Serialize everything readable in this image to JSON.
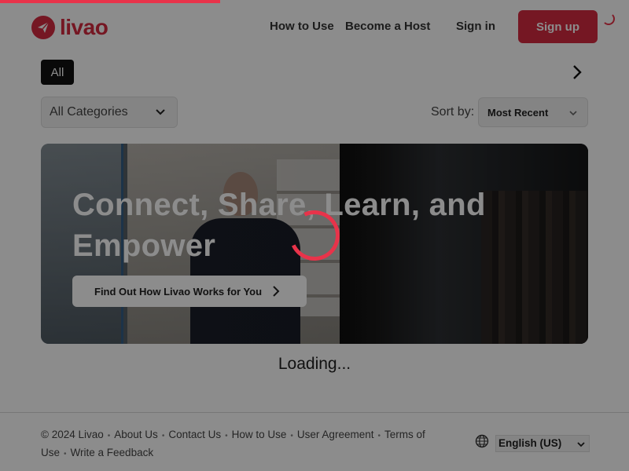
{
  "page_loading": {
    "progress_percent": 35
  },
  "brand": {
    "name": "livao",
    "color": "#d62a40"
  },
  "header": {
    "nav": [
      "How to Use",
      "Become a Host",
      "Sign in"
    ],
    "signup_label": "Sign up"
  },
  "filters": {
    "chip_all": "All",
    "category": "All Categories",
    "sort_label": "Sort by:",
    "sort_value": "Most Recent"
  },
  "hero": {
    "title": "Connect, Share, Learn, and Empower",
    "button_label": "Find Out How Livao Works for You"
  },
  "status": {
    "loading_text": "Loading..."
  },
  "footer": {
    "copyright": "© 2024 Livao",
    "links": [
      "About Us",
      "Contact Us",
      "How to Use",
      "User Agreement",
      "Terms of Use",
      "Write a Feedback"
    ],
    "language": "English (US)"
  },
  "colors": {
    "accent": "#e8334a",
    "dark": "#111111"
  }
}
